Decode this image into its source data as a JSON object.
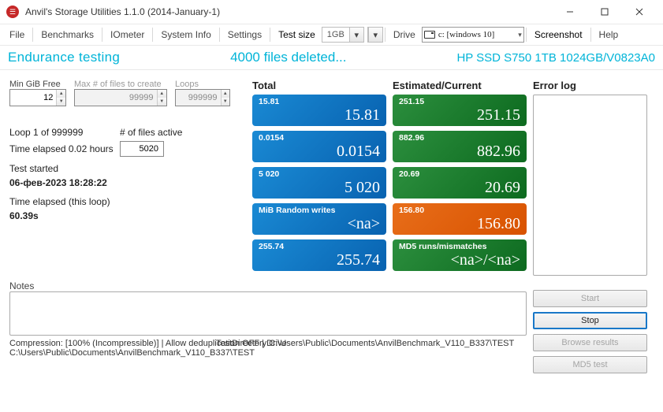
{
  "window": {
    "title": "Anvil's Storage Utilities 1.1.0 (2014-January-1)"
  },
  "menu": {
    "file": "File",
    "benchmarks": "Benchmarks",
    "iometer": "IOmeter",
    "sysinfo": "System Info",
    "settings": "Settings",
    "testsize_label": "Test size",
    "testsize_val": "1GB",
    "drive_label": "Drive",
    "drive_val": "c: [windows 10]",
    "screenshot": "Screenshot",
    "help": "Help"
  },
  "status": {
    "left": "Endurance testing",
    "mid": "4000 files deleted...",
    "right": "HP SSD S750 1TB 1024GB/V0823A0"
  },
  "left": {
    "min_gib_label": "Min GiB Free",
    "maxfiles_label": "Max # of files to create",
    "loops_label": "Loops",
    "min_gib": "12",
    "maxfiles": "99999",
    "loops": "999999",
    "loop_of": "Loop 1 of 999999",
    "files_active_label": "# of files active",
    "files_active": "5020",
    "time_elapsed": "Time elapsed 0.02 hours",
    "test_started_label": "Test started",
    "test_started": "06-фев-2023 18:28:22",
    "time_loop_label": "Time elapsed (this loop)",
    "time_loop": "60.39s",
    "notes_label": "Notes",
    "compression": "Compression: [100% (Incompressible)] | Allow deduplication OFF | Drive C:\\Users\\Public\\Documents\\AnvilBenchmark_V110_B337\\TEST",
    "compression2": "TestDirectory C:\\Users\\Public\\Documents\\AnvilBenchmark_V110_B337\\TEST"
  },
  "total": {
    "header": "Total",
    "t1s": "15.81",
    "t1b": "15.81",
    "t2s": "0.0154",
    "t2b": "0.0154",
    "t3s": "5 020",
    "t3b": "5 020",
    "t4s": "MiB Random writes",
    "t4b": "<na>",
    "t5s": "255.74",
    "t5b": "255.74"
  },
  "est": {
    "header": "Estimated/Current",
    "e1s": "251.15",
    "e1b": "251.15",
    "e2s": "882.96",
    "e2b": "882.96",
    "e3s": "20.69",
    "e3b": "20.69",
    "e4s": "156.80",
    "e4b": "156.80",
    "e5s": "MD5 runs/mismatches",
    "e5b": "<na>/<na>"
  },
  "err": {
    "header": "Error log"
  },
  "buttons": {
    "start": "Start",
    "stop": "Stop",
    "browse": "Browse results",
    "md5": "MD5 test"
  }
}
